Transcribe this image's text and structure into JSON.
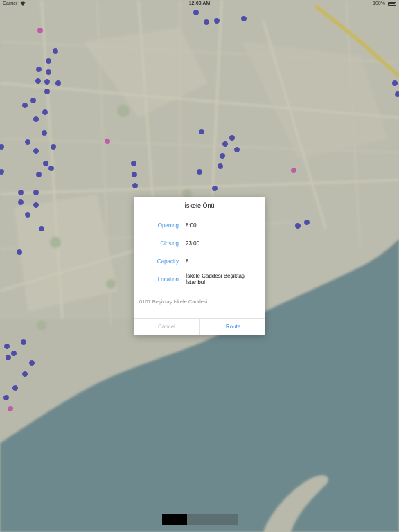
{
  "status_bar": {
    "carrier": "Carrier",
    "time": "12:00 AM",
    "battery_percent": "100%"
  },
  "map": {
    "land_color": "#b9b9ab",
    "water_color": "#6f8a8e",
    "poi_colors": {
      "parking": "#3a3aa8",
      "other": "#c040a0"
    }
  },
  "dialog": {
    "title": "İskele Önü",
    "fields": [
      {
        "label": "Opening",
        "value": "8:00"
      },
      {
        "label": "Closing",
        "value": "23:00"
      },
      {
        "label": "Capacity",
        "value": "8"
      },
      {
        "label": "Location",
        "value_lines": [
          "İskele Caddesi Beşiktaş",
          "İstanbul"
        ]
      }
    ],
    "address": "0107 Beşiktaş İskele Caddesi",
    "cancel_label": "Cancel",
    "route_label": "Route",
    "accent_color": "#3a8ee6"
  }
}
